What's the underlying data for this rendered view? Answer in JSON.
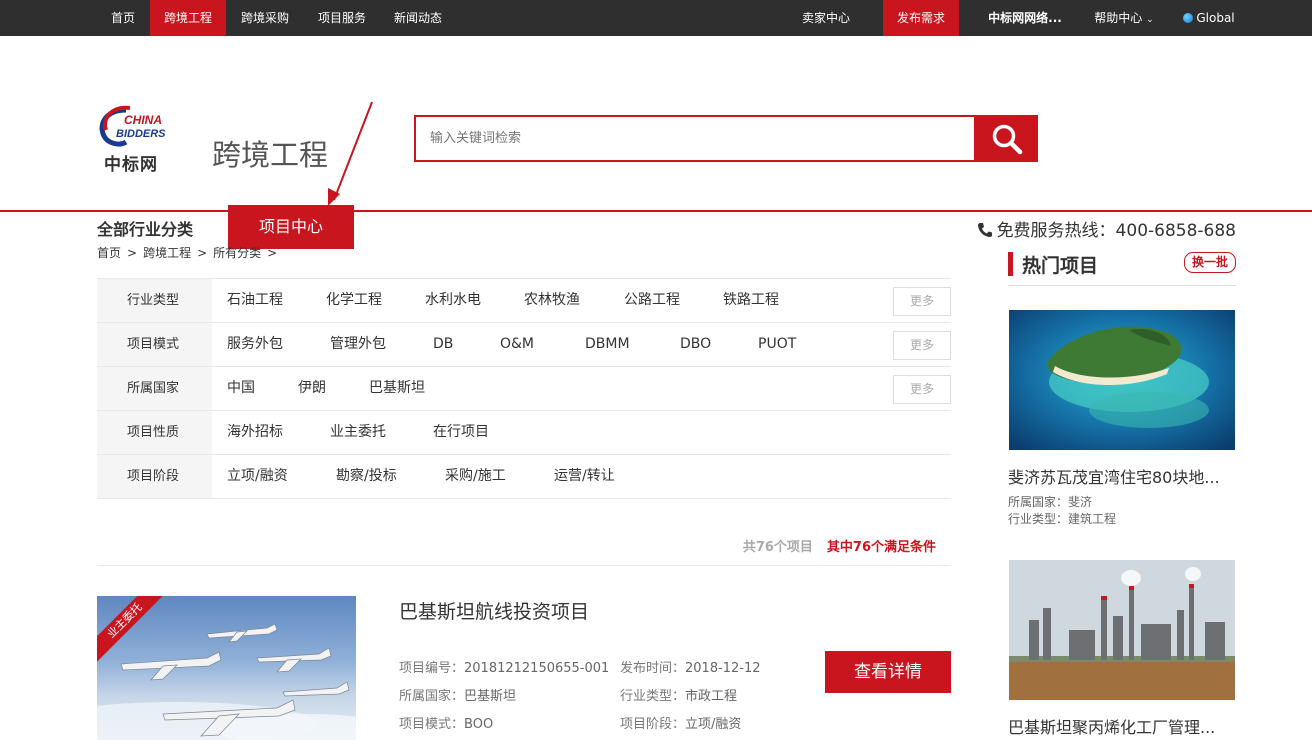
{
  "topnav": {
    "left": [
      "首页",
      "跨境工程",
      "跨境采购",
      "项目服务",
      "新闻动态"
    ],
    "active_index": 1,
    "seller": "卖家中心",
    "publish": "发布需求",
    "company": "中标网网络...",
    "help": "帮助中心",
    "global": "Global"
  },
  "header": {
    "logo_text": "中标网",
    "logo_brand_top": "CHINA",
    "logo_brand_bottom": "BIDDERS",
    "site_title": "跨境工程",
    "search_placeholder": "输入关键词检索",
    "nav_all": "全部行业分类",
    "nav_tab": "项目中心",
    "hotline": "免费服务热线：400-6858-688"
  },
  "breadcrumb": [
    "首页",
    ">",
    "跨境工程",
    ">",
    "所有分类",
    ">"
  ],
  "filters": [
    {
      "label": "行业类型",
      "options": [
        "石油工程",
        "化学工程",
        "水利水电",
        "农林牧渔",
        "公路工程",
        "铁路工程"
      ],
      "more": "更多"
    },
    {
      "label": "项目模式",
      "options": [
        "服务外包",
        "管理外包",
        "DB",
        "O&M",
        "DBMM",
        "DBO",
        "PUOT"
      ],
      "more": "更多"
    },
    {
      "label": "所属国家",
      "options": [
        "中国",
        "伊朗",
        "巴基斯坦"
      ],
      "more": "更多"
    },
    {
      "label": "项目性质",
      "options": [
        "海外招标",
        "业主委托",
        "在行项目"
      ],
      "more": ""
    },
    {
      "label": "项目阶段",
      "options": [
        "立项/融资",
        "勘察/投标",
        "采购/施工",
        "运营/转让"
      ],
      "more": ""
    }
  ],
  "result_count": {
    "total": "共76个项目",
    "match": "其中76个满足条件"
  },
  "project": {
    "ribbon": "业主委托",
    "title": "巴基斯坦航线投资项目",
    "fields": [
      {
        "k": "项目编号：",
        "v": "20181212150655-001"
      },
      {
        "k": "发布时间：",
        "v": "2018-12-12"
      },
      {
        "k": "所属国家：",
        "v": "巴基斯坦"
      },
      {
        "k": "行业类型：",
        "v": "市政工程"
      },
      {
        "k": "项目模式：",
        "v": "BOO"
      },
      {
        "k": "项目阶段：",
        "v": "立项/融资"
      }
    ],
    "button": "查看详情"
  },
  "sidebar": {
    "title": "热门项目",
    "refresh": "换一批",
    "cards": [
      {
        "title": "斐济苏瓦茂宜湾住宅80块地...",
        "country_label": "所属国家：",
        "country": "斐济",
        "industry_label": "行业类型：",
        "industry": "建筑工程"
      },
      {
        "title": "巴基斯坦聚丙烯化工厂管理..."
      }
    ]
  }
}
